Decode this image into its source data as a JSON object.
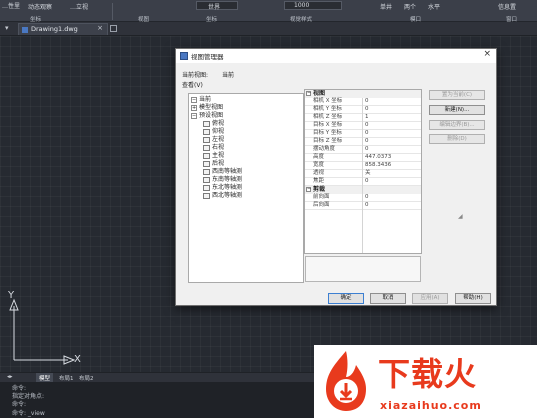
{
  "ribbon": {
    "top_items": [
      "…性里",
      "动态观察",
      "…立视",
      "世界",
      "1000",
      "单井",
      "两个",
      "水平",
      "信息置"
    ],
    "panels": [
      "坐标",
      "视图",
      "坐标",
      "视觉样式",
      "模口",
      "窗口"
    ]
  },
  "tabbar": {
    "doc_name": "Drawing1.dwg",
    "close": "×"
  },
  "ucs": {
    "y": "Y",
    "x": "X"
  },
  "layout_tabs": [
    "模型",
    "布局1",
    "布局2"
  ],
  "command_lines": [
    "命令:",
    "指定对角点:",
    "命令:",
    "命令: _view"
  ],
  "dialog": {
    "title": "视图管理器",
    "close": "×",
    "current_view_label": "当前视图:",
    "current_view_value": "当前",
    "list_label": "查看(V)",
    "tree": [
      {
        "label": "当前",
        "level": 1,
        "toggle": "−"
      },
      {
        "label": "模型视图",
        "level": 1,
        "toggle": "+"
      },
      {
        "label": "预设视图",
        "level": 1,
        "toggle": "−"
      },
      {
        "label": "俯视",
        "level": 2
      },
      {
        "label": "仰视",
        "level": 2
      },
      {
        "label": "左视",
        "level": 2
      },
      {
        "label": "右视",
        "level": 2
      },
      {
        "label": "主视",
        "level": 2
      },
      {
        "label": "后视",
        "level": 2
      },
      {
        "label": "西南等轴测",
        "level": 2
      },
      {
        "label": "东南等轴测",
        "level": 2
      },
      {
        "label": "东北等轴测",
        "level": 2
      },
      {
        "label": "西北等轴测",
        "level": 2
      }
    ],
    "props": {
      "cat1": "视图",
      "cat2": "剪裁",
      "rows1": [
        {
          "k": "相机 X 坐标",
          "v": "0"
        },
        {
          "k": "相机 Y 坐标",
          "v": "0"
        },
        {
          "k": "相机 Z 坐标",
          "v": "1"
        },
        {
          "k": "目标 X 坐标",
          "v": "0"
        },
        {
          "k": "目标 Y 坐标",
          "v": "0"
        },
        {
          "k": "目标 Z 坐标",
          "v": "0"
        },
        {
          "k": "摆动角度",
          "v": "0"
        },
        {
          "k": "高度",
          "v": "447.0373"
        },
        {
          "k": "宽度",
          "v": "858.3436"
        },
        {
          "k": "透视",
          "v": "关"
        },
        {
          "k": "焦距",
          "v": "0"
        }
      ],
      "rows2": [
        {
          "k": "前向面",
          "v": "0"
        },
        {
          "k": "后向面",
          "v": "0"
        }
      ]
    },
    "right_buttons": [
      {
        "label": "置为当前(C)",
        "enabled": false
      },
      {
        "label": "新建(N)...",
        "enabled": true
      },
      {
        "label": "编辑边界(B)...",
        "enabled": false
      },
      {
        "label": "删除(D)",
        "enabled": false
      }
    ],
    "bottom_buttons": {
      "ok": "确定",
      "cancel": "取消",
      "apply": "应用(A)",
      "help": "帮助(H)"
    }
  },
  "watermark": {
    "title": "下载火",
    "url": "xiazaihuo.com"
  }
}
